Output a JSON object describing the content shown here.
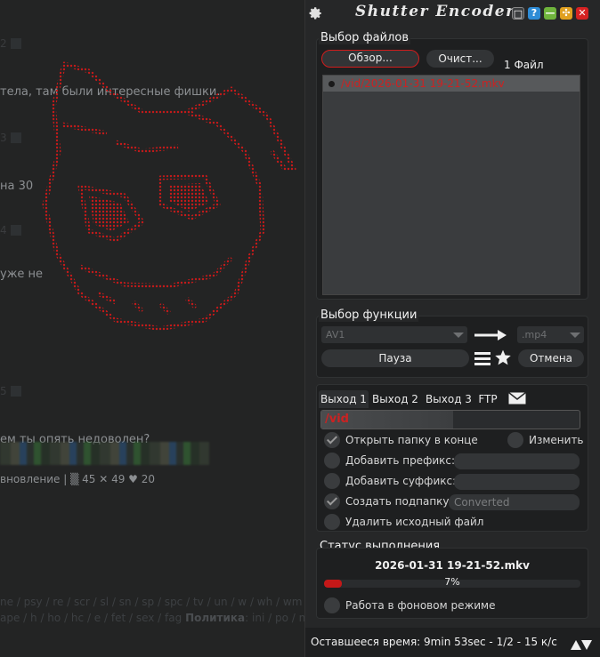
{
  "background": {
    "text_lines": [
      {
        "text": "тела, там были интересные фишки."
      },
      {
        "text": "на 30"
      },
      {
        "text": "уже не"
      },
      {
        "text": "ем ты опять недоволен?"
      },
      {
        "text": "вновление | ▒ 45 ✕ 49 ♥ 20"
      }
    ],
    "numbers": [
      "2",
      "3",
      "4",
      "5"
    ],
    "links_line1": "ne / psy / re / scr / sl / sn / sp / spc / tv / un / w / wh / wm /",
    "links_line2": "ape / h / ho / hc / e / fet / sex / fag",
    "links_bold": "Политика",
    "links_after": ": ini / po / ne"
  },
  "app": {
    "title": "Shutter Encoder",
    "window_buttons": [
      "□",
      "?",
      "—",
      "✣",
      "✕"
    ],
    "colors": {
      "accent": "#d01c1c",
      "help": "#2e8cd6",
      "minimize": "#6fb43c",
      "maximize": "#e0a020",
      "close": "#d62222"
    },
    "file_section": {
      "title": "Выбор файлов",
      "browse_label": "Обзор...",
      "clear_label": "Очист...",
      "count": "1 Файл",
      "files": [
        "/vid/2026-01-31 19-21-52.mkv"
      ]
    },
    "function_section": {
      "title": "Выбор функции",
      "codec": "AV1",
      "container": ".mp4",
      "pause_label": "Пауза",
      "cancel_label": "Отмена"
    },
    "output_section": {
      "tabs": [
        "Выход 1",
        "Выход 2",
        "Выход 3",
        "FTP"
      ],
      "output_path": "/vid",
      "open_folder_label": "Открыть папку в конце",
      "change_label": "Изменить",
      "prefix_label": "Добавить префикс:",
      "suffix_label": "Добавить суффикс:",
      "subfolder_label": "Создать подпапку:",
      "subfolder_value": "Converted",
      "delete_source_label": "Удалить исходный файл"
    },
    "progress_section": {
      "title": "Статус выполнения",
      "current_file": "2026-01-31 19-21-52.mkv",
      "percent_label": "7%",
      "percent_value": 0.07,
      "background_label": "Работа в фоновом режиме"
    },
    "status_line": "Оставшееся время: 9min 53sec - 1/2 - 15 к/с"
  }
}
